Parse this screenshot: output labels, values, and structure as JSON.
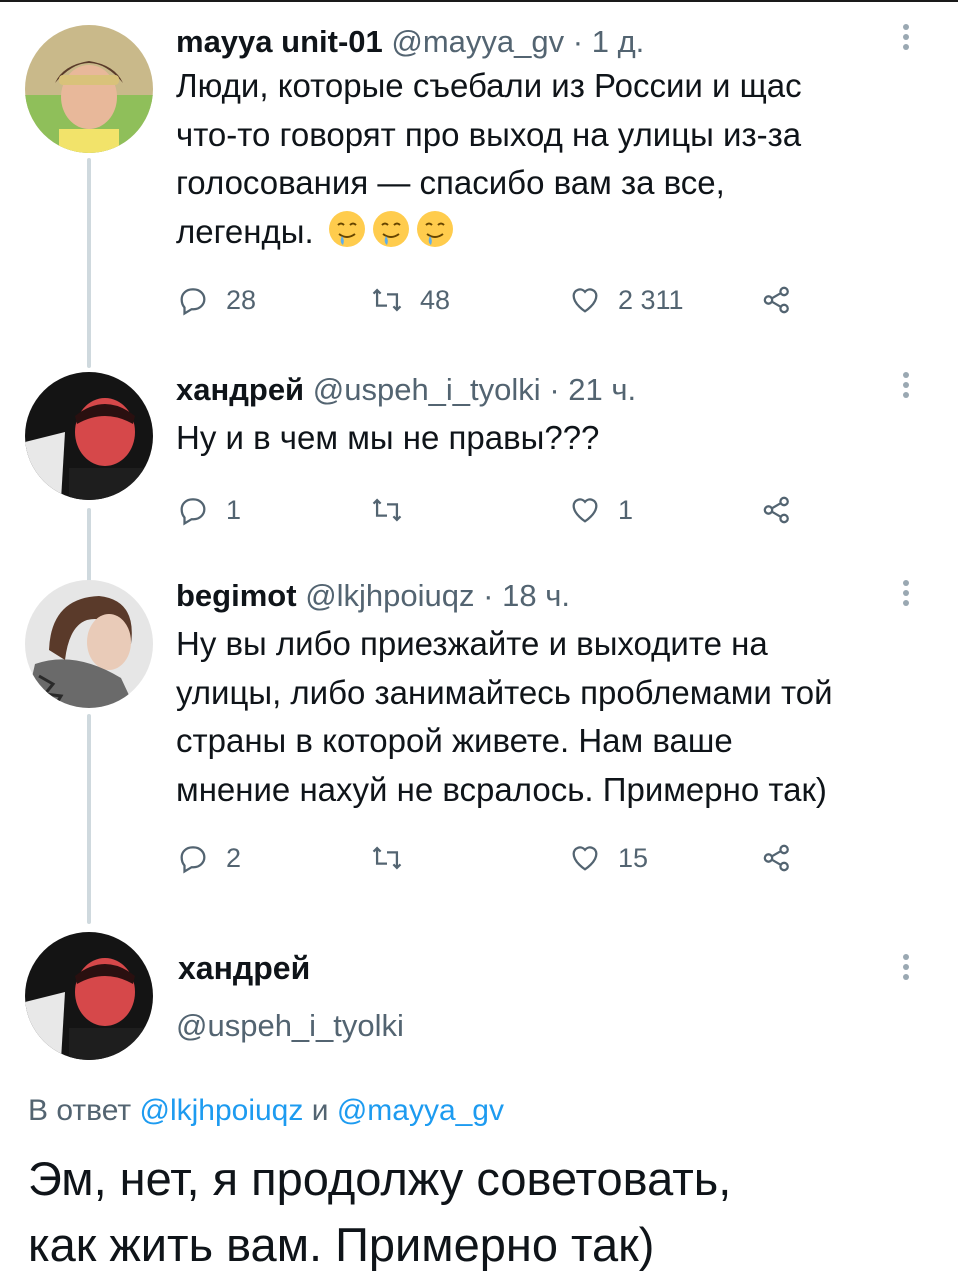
{
  "colors": {
    "accent": "#1d9bf0",
    "secondary_text": "#536471",
    "thread_line": "#cfd9de"
  },
  "tweets": [
    {
      "name": "mayya unit-01",
      "handle": "@mayya_gv",
      "sep": "·",
      "time": "1 д.",
      "lines": [
        "Люди, которые съебали из России и щас",
        "что-то говорят про выход на улицы из-за",
        "голосования — спасибо вам за все,",
        "легенды."
      ],
      "emoji": [
        "drooling-face",
        "drooling-face",
        "drooling-face"
      ],
      "replies": "28",
      "retweets": "48",
      "likes": "2 311"
    },
    {
      "name": "хандрей",
      "handle": "@uspeh_i_tyolki",
      "sep": "·",
      "time": "21 ч.",
      "lines": [
        "Ну и в чем мы не правы???"
      ],
      "replies": "1",
      "retweets": "",
      "likes": "1"
    },
    {
      "name": "begimot",
      "handle": "@lkjhpoiuqz",
      "sep": "·",
      "time": "18 ч.",
      "lines": [
        "Ну вы либо приезжайте и выходите на",
        "улицы, либо занимайтесь проблемами той",
        "страны в которой живете. Нам ваше",
        "мнение нахуй не всралось. Примерно так)"
      ],
      "replies": "2",
      "retweets": "",
      "likes": "15"
    }
  ],
  "main": {
    "name": "хандрей",
    "handle": "@uspeh_i_tyolki",
    "reply_prefix": "В ответ",
    "reply_user1": "@lkjhpoiuqz",
    "reply_and": "и",
    "reply_user2": "@mayya_gv",
    "lines": [
      "Эм, нет, я продолжу советовать,",
      "как жить вам. Примерно так)"
    ]
  },
  "icons": {
    "reply": "speech-bubble-icon",
    "retweet": "retweet-icon",
    "like": "heart-icon",
    "share": "share-icon",
    "more": "vertical-ellipsis-icon"
  }
}
